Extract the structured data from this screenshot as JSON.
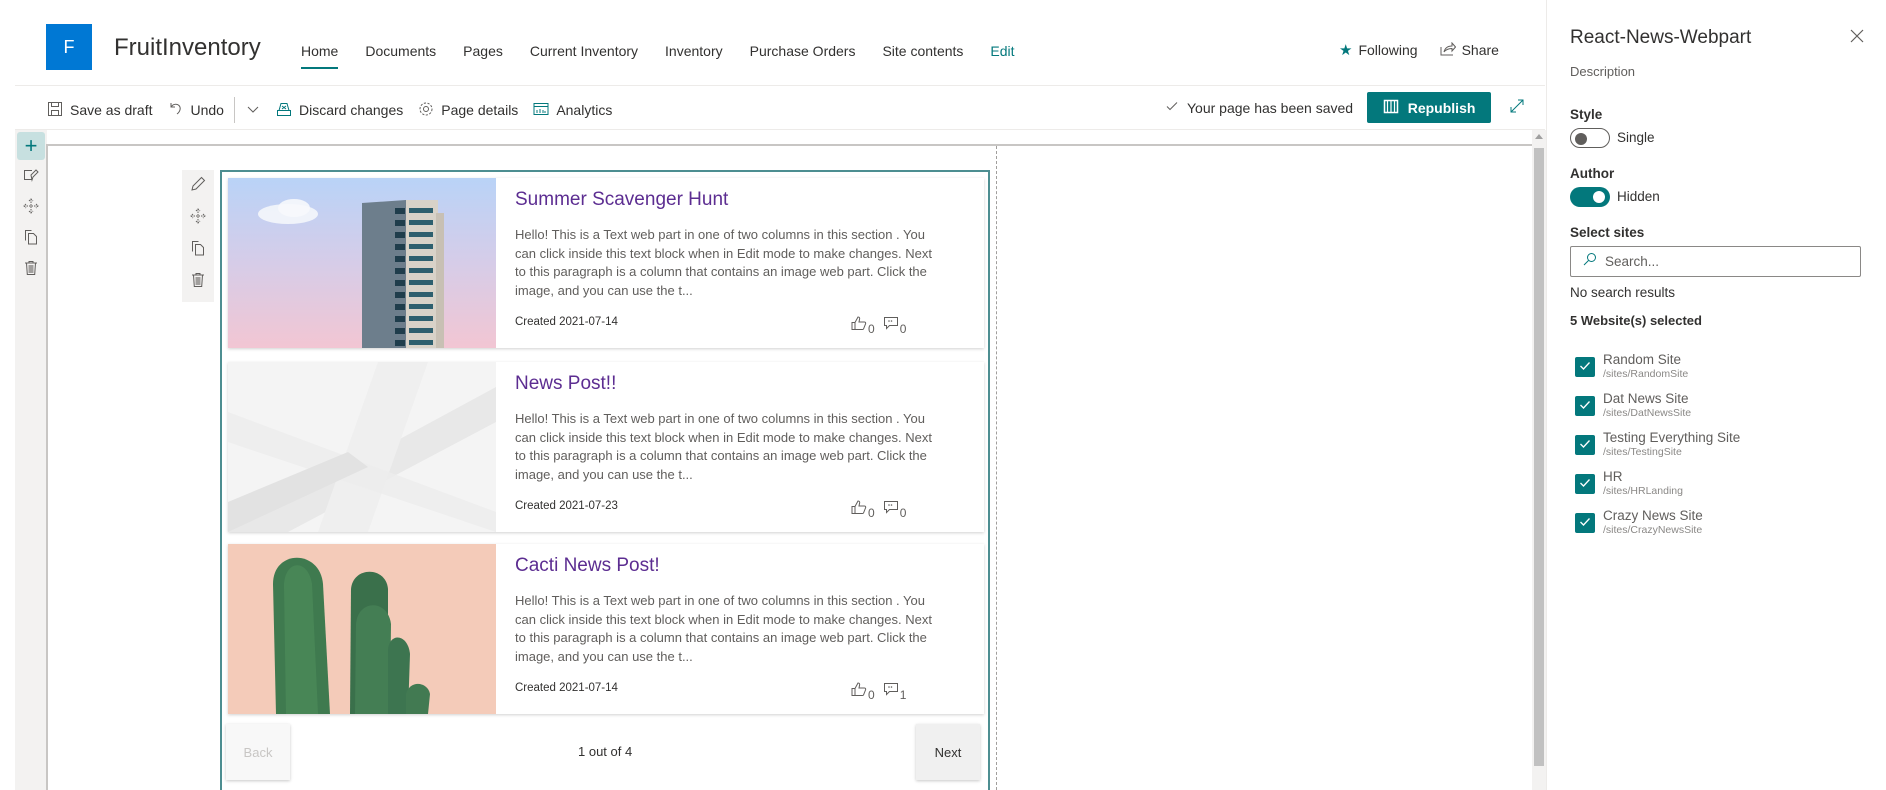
{
  "header": {
    "logo_letter": "F",
    "site_title": "FruitInventory",
    "nav": [
      {
        "label": "Home",
        "active": true
      },
      {
        "label": "Documents"
      },
      {
        "label": "Pages"
      },
      {
        "label": "Current Inventory"
      },
      {
        "label": "Inventory"
      },
      {
        "label": "Purchase Orders"
      },
      {
        "label": "Site contents"
      },
      {
        "label": "Edit"
      }
    ],
    "following_label": "Following",
    "share_label": "Share"
  },
  "commandbar": {
    "save_draft": "Save as draft",
    "undo": "Undo",
    "discard": "Discard changes",
    "page_details": "Page details",
    "analytics": "Analytics",
    "saved_status": "Your page has been saved",
    "republish": "Republish"
  },
  "news": {
    "items": [
      {
        "title": "Summer Scavenger Hunt",
        "description": "Hello! This is a Text web part in one of two columns in this section . You can click inside this text block when in Edit mode to make changes. Next to this paragraph is a column that contains an image web part. Click the image, and you can use the t...",
        "created": "Created 2021-07-14",
        "likes": "0",
        "comments": "0",
        "image": "building-sky"
      },
      {
        "title": "News Post!!",
        "description": "Hello! This is a Text web part in one of two columns in this section . You can click inside this text block when in Edit mode to make changes. Next to this paragraph is a column that contains an image web part. Click the image, and you can use the t...",
        "created": "Created 2021-07-23",
        "likes": "0",
        "comments": "0",
        "image": "gray-abstract"
      },
      {
        "title": "Cacti News Post!",
        "description": "Hello! This is a Text web part in one of two columns in this section . You can click inside this text block when in Edit mode to make changes. Next to this paragraph is a column that contains an image web part. Click the image, and you can use the t...",
        "created": "Created 2021-07-14",
        "likes": "0",
        "comments": "1",
        "image": "cactus"
      }
    ],
    "pager": {
      "back": "Back",
      "next": "Next",
      "status": "1 out of 4"
    }
  },
  "pane": {
    "title": "React-News-Webpart",
    "description": "Description",
    "style_label": "Style",
    "style_toggle_text": "Single",
    "style_on": false,
    "author_label": "Author",
    "author_toggle_text": "Hidden",
    "author_on": true,
    "select_sites_label": "Select sites",
    "search_placeholder": "Search...",
    "search_value": "",
    "no_results": "No search results",
    "selected_count": "5 Website(s) selected",
    "sites": [
      {
        "name": "Random Site",
        "url": "/sites/RandomSite",
        "checked": true
      },
      {
        "name": "Dat News Site",
        "url": "/sites/DatNewsSite",
        "checked": true
      },
      {
        "name": "Testing Everything Site",
        "url": "/sites/TestingSite",
        "checked": true
      },
      {
        "name": "HR",
        "url": "/sites/HRLanding",
        "checked": true
      },
      {
        "name": "Crazy News Site",
        "url": "/sites/CrazyNewsSite",
        "checked": true
      }
    ]
  },
  "colors": {
    "accent": "#03787c",
    "logo": "#0078d4",
    "news_title": "#5c2d91"
  }
}
